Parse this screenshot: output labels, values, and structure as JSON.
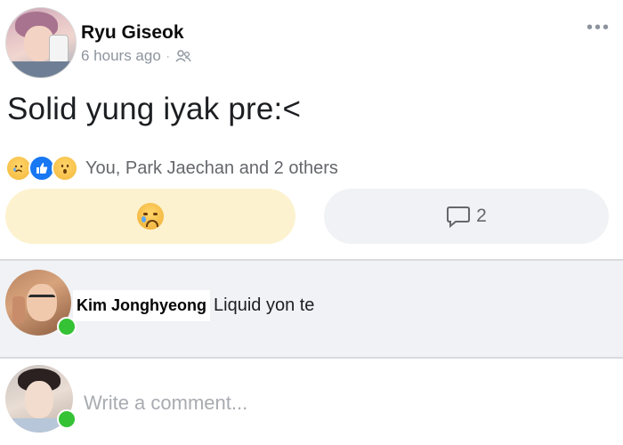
{
  "post": {
    "author": "Ryu Giseok",
    "time": "6 hours ago",
    "separator": "·",
    "audience_icon": "friends-icon",
    "more_label": "•••",
    "text": "Solid yung iyak pre:<",
    "reactions": {
      "icons": [
        "sad-reaction-icon",
        "like-reaction-icon",
        "wow-reaction-icon"
      ],
      "summary": "You, Park Jaechan and 2 others"
    },
    "actions": {
      "react_icon": "sad-emoji-icon",
      "comment_icon": "comment-icon",
      "comment_count": "2"
    }
  },
  "comment": {
    "author": "Kim Jonghyeong",
    "text": "Liquid yon te",
    "online": true
  },
  "composer": {
    "placeholder": "Write a comment..."
  },
  "colors": {
    "react_button_bg": "#fdf2cf",
    "comment_button_bg": "#f0f2f5",
    "online_green": "#35c235",
    "like_blue": "#1877f2"
  }
}
